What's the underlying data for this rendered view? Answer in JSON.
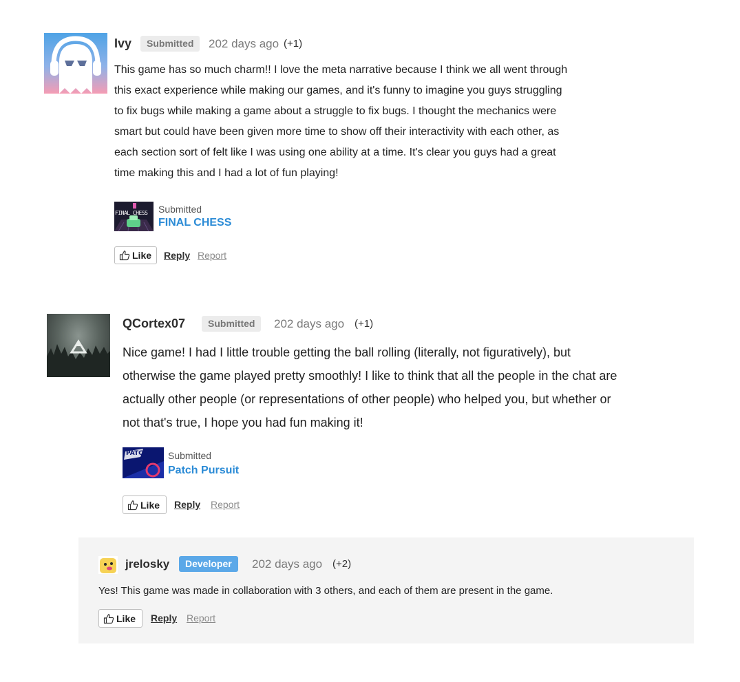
{
  "comments": [
    {
      "username": "Ivy",
      "badge": "Submitted",
      "time": "202 days ago",
      "votes": "(+1)",
      "avatar_icon": "ghost-headphones-icon",
      "body_lines": [
        "This game has so much charm!! I love the meta narrative because I think we all went through",
        "this exact experience while making our games, and it's funny to imagine you guys struggling",
        "to fix bugs while making a game about a struggle to fix bugs. I thought the mechanics were",
        "smart but could have been given more time to show off their interactivity with each other, as",
        "each section sort of felt like I was using one ability at a time. It's clear you guys had a great",
        "time making this and I had a lot of fun playing!"
      ],
      "game": {
        "label": "Submitted",
        "title": "FINAL CHESS",
        "thumb_text": "FINAL CHESS"
      },
      "actions": {
        "like": "Like",
        "reply": "Reply",
        "report": "Report"
      }
    },
    {
      "username": "QCortex07",
      "badge": "Submitted",
      "time": "202 days ago",
      "votes": "(+1)",
      "avatar_icon": "forest-triangle-icon",
      "body_lines": [
        "Nice game! I had I little trouble getting the ball rolling (literally, not figuratively), but",
        "otherwise the game played pretty smoothly! I like to think that all the people in the chat are",
        "actually other people (or representations of other people) who helped you, but whether or",
        "not that's true, I hope you had fun making it!"
      ],
      "game": {
        "label": "Submitted",
        "title": "Patch Pursuit",
        "thumb_text": "PATCH"
      },
      "actions": {
        "like": "Like",
        "reply": "Reply",
        "report": "Report"
      }
    }
  ],
  "reply": {
    "username": "jrelosky",
    "badge": "Developer",
    "time": "202 days ago",
    "votes": "(+2)",
    "avatar_icon": "smiley-face-icon",
    "body": "Yes! This game was made in collaboration with 3 others, and each of them are present in the game.",
    "actions": {
      "like": "Like",
      "reply": "Reply",
      "report": "Report"
    }
  },
  "colors": {
    "link": "#2b8bd6",
    "developer_badge": "#5ba8e8",
    "submitted_badge_bg": "#ececec",
    "reply_panel_bg": "#f4f4f4"
  }
}
